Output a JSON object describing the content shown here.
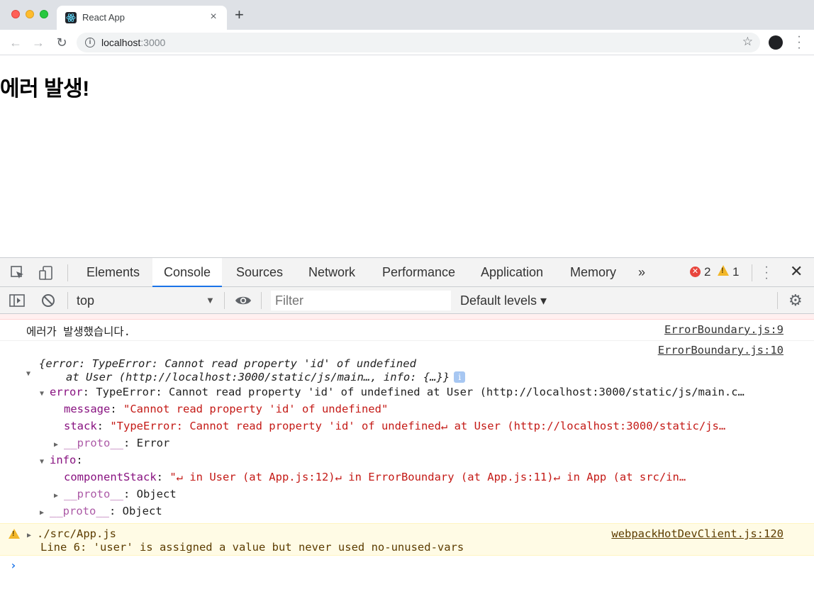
{
  "browser": {
    "tab_title": "React App",
    "tab_close": "×",
    "new_tab": "+",
    "url_host": "localhost",
    "url_port": ":3000"
  },
  "page": {
    "heading": "에러 발생!"
  },
  "devtools": {
    "tabs": [
      {
        "label": "Elements"
      },
      {
        "label": "Console"
      },
      {
        "label": "Sources"
      },
      {
        "label": "Network"
      },
      {
        "label": "Performance"
      },
      {
        "label": "Application"
      },
      {
        "label": "Memory"
      }
    ],
    "more_tabs": "»",
    "error_count": "2",
    "warning_count": "1",
    "context": "top",
    "filter_placeholder": "Filter",
    "levels": "Default levels ▾"
  },
  "console": {
    "log1": {
      "text": "에러가 발생했습니다.",
      "source": "ErrorBoundary.js:9"
    },
    "log2": {
      "source": "ErrorBoundary.js:10",
      "summary_line1": "{error: TypeError: Cannot read property 'id' of undefined",
      "summary_line2": "at User (http://localhost:3000/static/js/main…, info: {…}}",
      "error_key": "error",
      "error_value": "TypeError: Cannot read property 'id' of undefined at User (http://localhost:3000/static/js/main.c…",
      "message_key": "message",
      "message_value": "\"Cannot read property 'id' of undefined\"",
      "stack_key": "stack",
      "stack_value": "\"TypeError: Cannot read property 'id' of undefined↵    at User (http://localhost:3000/static/js…",
      "proto_key": "__proto__",
      "proto_error": "Error",
      "info_key": "info",
      "component_stack_key": "componentStack",
      "component_stack_value": "\"↵    in User (at App.js:12)↵    in ErrorBoundary (at App.js:11)↵    in App (at src/in…",
      "proto_object": "Object"
    },
    "warning": {
      "file": "./src/App.js",
      "source": "webpackHotDevClient.js:120",
      "message": "Line 6:  'user' is assigned a value but never used  no-unused-vars"
    },
    "prompt": "›"
  }
}
